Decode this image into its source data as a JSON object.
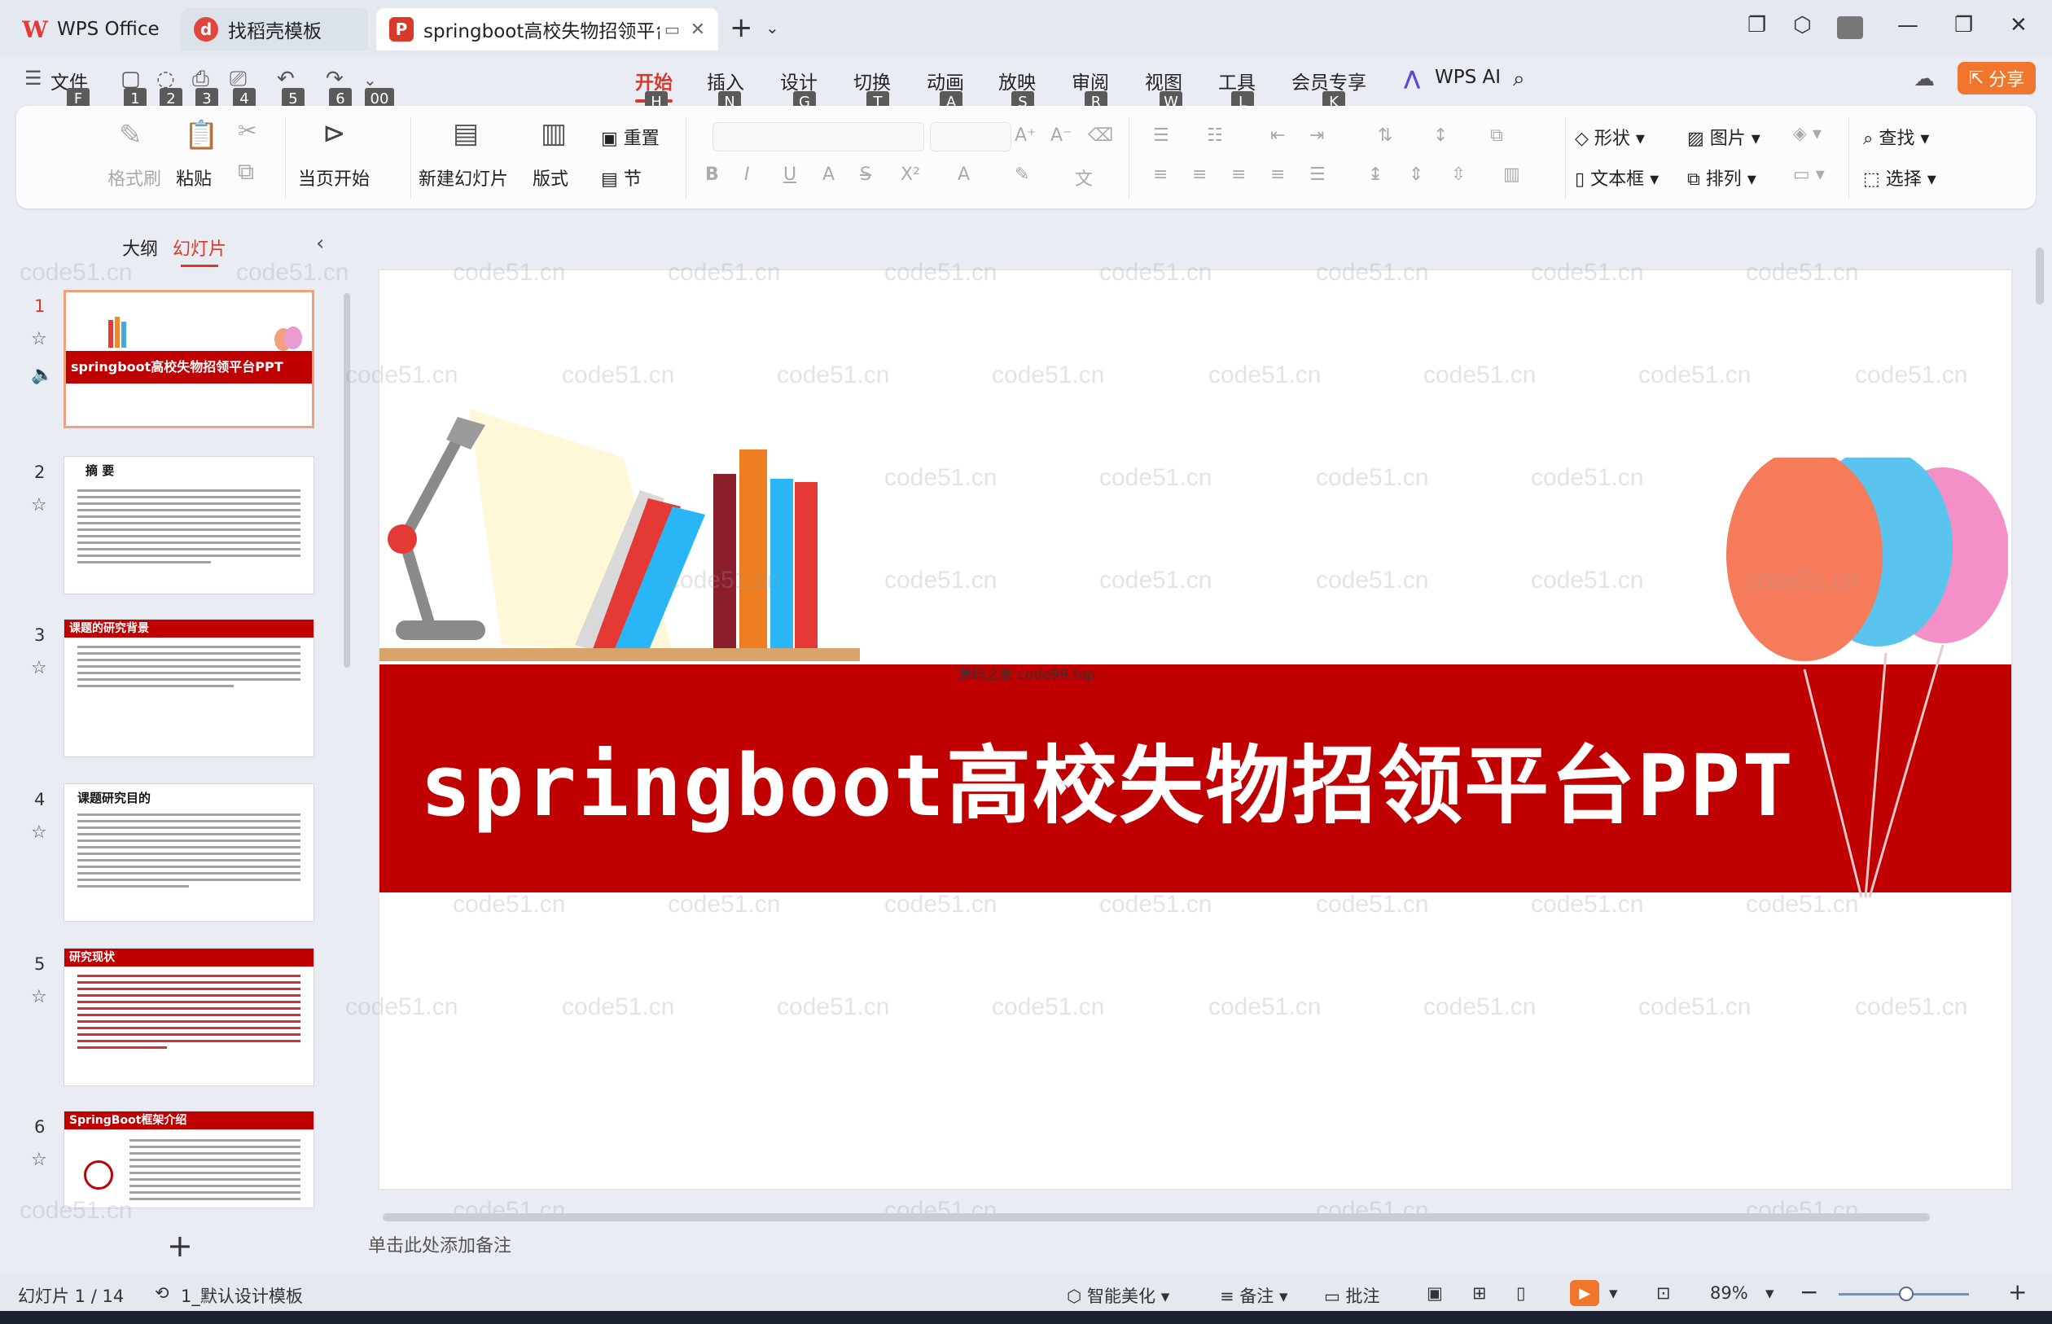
{
  "titlebar": {
    "tabs": [
      {
        "label": "WPS Office"
      },
      {
        "label": "找稻壳模板"
      },
      {
        "label": "springboot高校失物招领平台PPT"
      }
    ]
  },
  "menu": {
    "file": "文件",
    "items": [
      "开始",
      "插入",
      "设计",
      "切换",
      "动画",
      "放映",
      "审阅",
      "视图",
      "工具",
      "会员专享"
    ],
    "keys": [
      "H",
      "N",
      "G",
      "T",
      "A",
      "S",
      "R",
      "W",
      "L",
      "K"
    ],
    "qa_keys": [
      "F",
      "1",
      "2",
      "3",
      "4",
      "5",
      "6",
      "00"
    ],
    "ai": "WPS AI",
    "share": "分享"
  },
  "ribbon": {
    "format_painter": "格式刷",
    "paste": "粘贴",
    "play_from_current": "当页开始",
    "new_slide": "新建幻灯片",
    "layout": "版式",
    "reset": "重置",
    "section": "节",
    "shape": "形状",
    "picture": "图片",
    "textbox": "文本框",
    "arrange": "排列",
    "find": "查找",
    "select": "选择"
  },
  "leftpanel": {
    "outline_tab": "大纲",
    "slides_tab": "幻灯片",
    "slides": [
      {
        "num": "1",
        "title": "springboot高校失物招领平台PPT"
      },
      {
        "num": "2",
        "title": "摘  要"
      },
      {
        "num": "3",
        "title": "课题的研究背景"
      },
      {
        "num": "4",
        "title": "课题研究目的"
      },
      {
        "num": "5",
        "title": "研究现状"
      },
      {
        "num": "6",
        "title": "SpringBoot框架介绍"
      }
    ]
  },
  "slide": {
    "title_latin": "springboot",
    "title_cjk": "高校失物招领平台",
    "title_suffix": "PPT",
    "source_label": "源码之家 code99.top"
  },
  "watermark_text": "code51.cn",
  "notes_placeholder": "单击此处添加备注",
  "statusbar": {
    "slide_counter": "幻灯片 1 / 14",
    "template": "1_默认设计模板",
    "beautify": "智能美化",
    "notes": "备注",
    "comment": "批注",
    "zoom": "89%"
  },
  "colors": {
    "accent": "#d9392b",
    "band": "#c00000",
    "share": "#f0762e"
  }
}
